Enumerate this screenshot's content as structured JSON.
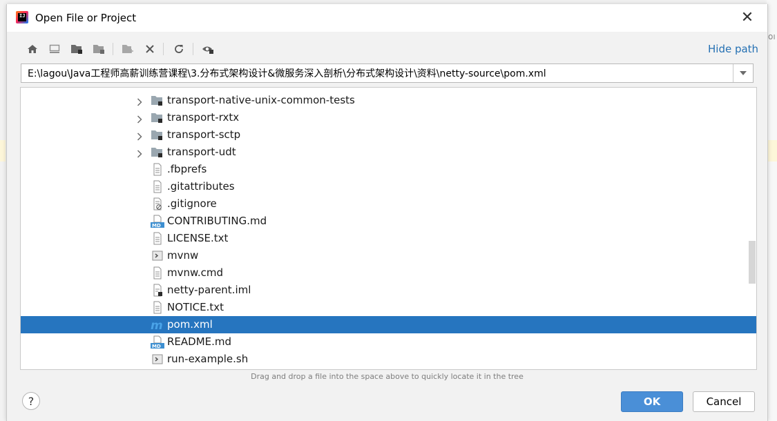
{
  "window": {
    "title": "Open File or Project",
    "close_glyph": "✕",
    "app_icon": "intellij-idea-icon"
  },
  "toolbar": {
    "buttons": [
      {
        "name": "home-icon"
      },
      {
        "name": "desktop-icon"
      },
      {
        "name": "project-folder-icon"
      },
      {
        "name": "module-folder-icon"
      },
      {
        "name": "new-folder-icon"
      },
      {
        "name": "delete-icon"
      },
      {
        "name": "refresh-icon"
      },
      {
        "name": "show-hidden-icon"
      }
    ],
    "hide_path_label": "Hide path"
  },
  "path": {
    "value": "E:\\lagou\\Java工程师高薪训练营课程\\3.分布式架构设计&微服务深入剖析\\分布式架构设计\\资料\\netty-source\\pom.xml"
  },
  "tree": {
    "items": [
      {
        "label": "transport-native-unix-common-tests",
        "type": "folder",
        "expandable": true
      },
      {
        "label": "transport-rxtx",
        "type": "folder",
        "expandable": true
      },
      {
        "label": "transport-sctp",
        "type": "folder",
        "expandable": true
      },
      {
        "label": "transport-udt",
        "type": "folder",
        "expandable": true
      },
      {
        "label": ".fbprefs",
        "type": "file"
      },
      {
        "label": ".gitattributes",
        "type": "file"
      },
      {
        "label": ".gitignore",
        "type": "ignore"
      },
      {
        "label": "CONTRIBUTING.md",
        "type": "markdown"
      },
      {
        "label": "LICENSE.txt",
        "type": "text"
      },
      {
        "label": "mvnw",
        "type": "shell"
      },
      {
        "label": "mvnw.cmd",
        "type": "text"
      },
      {
        "label": "netty-parent.iml",
        "type": "iml"
      },
      {
        "label": "NOTICE.txt",
        "type": "text"
      },
      {
        "label": "pom.xml",
        "type": "maven",
        "selected": true
      },
      {
        "label": "README.md",
        "type": "markdown"
      },
      {
        "label": "run-example.sh",
        "type": "shell"
      }
    ]
  },
  "hint": "Drag and drop a file into the space above to quickly locate it in the tree",
  "footer": {
    "help": "?",
    "ok": "OK",
    "cancel": "Cancel"
  },
  "colors": {
    "selection": "#2675bf",
    "link": "#2470b3",
    "primary_button": "#4a8fd7"
  }
}
